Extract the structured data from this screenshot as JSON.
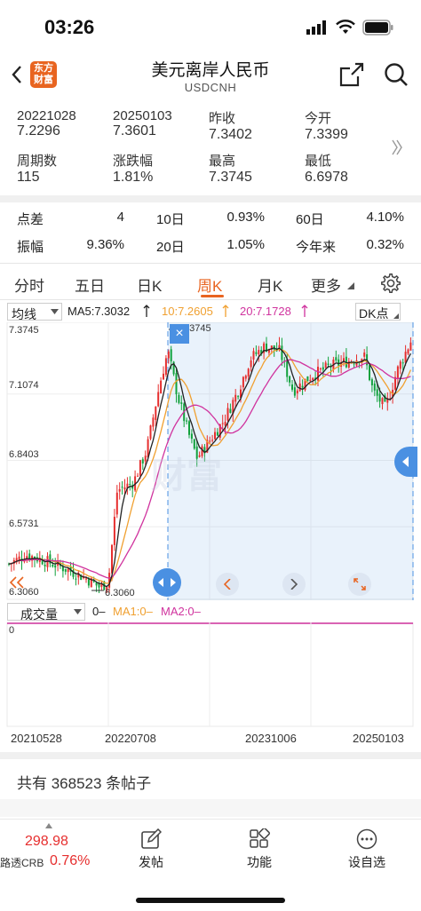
{
  "status": {
    "time": "03:26"
  },
  "nav": {
    "title": "美元离岸人民币",
    "subtitle": "USDCNH",
    "logo_line1": "东方",
    "logo_line2": "财富"
  },
  "stats": {
    "r1": [
      {
        "label": "20221028",
        "value": "7.2296",
        "color": "#333333"
      },
      {
        "label": "20250103",
        "value": "7.3601",
        "color": "#e62e2e"
      },
      {
        "label": "昨收",
        "value": "7.3402",
        "color": "#333333"
      },
      {
        "label": "今开",
        "value": "7.3399",
        "color": "#12a13d"
      }
    ],
    "r2": [
      {
        "label": "周期数",
        "value": "115",
        "color": "#333333"
      },
      {
        "label": "涨跌幅",
        "value": "1.81%",
        "color": "#e62e2e"
      },
      {
        "label": "最高",
        "value": "7.3745",
        "color": "#e62e2e"
      },
      {
        "label": "最低",
        "value": "6.6978",
        "color": "#12a13d"
      }
    ]
  },
  "metrics": {
    "spread_label": "点差",
    "spread_value": "4",
    "d10_label": "10日",
    "d10_value": "0.93%",
    "d60_label": "60日",
    "d60_value": "4.10%",
    "amp_label": "振幅",
    "amp_value": "9.36%",
    "d20_label": "20日",
    "d20_value": "1.05%",
    "ytd_label": "今年来",
    "ytd_value": "0.32%"
  },
  "tabs": [
    {
      "label": "分时",
      "active": false
    },
    {
      "label": "五日",
      "active": false
    },
    {
      "label": "日K",
      "active": false
    },
    {
      "label": "周K",
      "active": true
    },
    {
      "label": "月K",
      "active": false
    },
    {
      "label": "更多",
      "active": false
    }
  ],
  "ma_bar": {
    "select": "均线",
    "ma5": "MA5:7.3032",
    "ma10": "10:7.2605",
    "ma20": "20:7.1728",
    "dk": "DK点",
    "colors": {
      "ma5": "#222222",
      "ma10": "#f0a030",
      "ma20": "#d0339e"
    }
  },
  "chart_data": {
    "type": "candlestick",
    "y_ticks": [
      "7.3745",
      "7.1074",
      "6.8403",
      "6.5731",
      "6.3060"
    ],
    "ylim": [
      6.306,
      7.3745
    ],
    "high_label": "7.3745",
    "low_label": "6.3060",
    "x_ticks": [
      "20210528",
      "20220708",
      "20231006",
      "20250103"
    ],
    "colors": {
      "up": "#e62e2e",
      "down": "#12a13d"
    },
    "highlight_range": {
      "from": "20221028",
      "to": "20250103"
    }
  },
  "volume": {
    "select": "成交量",
    "vol": "0",
    "ma1": "MA1:0",
    "ma2": "MA2:0",
    "zero": "0"
  },
  "posts": {
    "text": "共有 368523 条帖子"
  },
  "bottom": {
    "index_value": "298.98",
    "index_name": "路透CRB",
    "index_change": "0.76%",
    "post": "发帖",
    "func": "功能",
    "watch": "设自选"
  }
}
